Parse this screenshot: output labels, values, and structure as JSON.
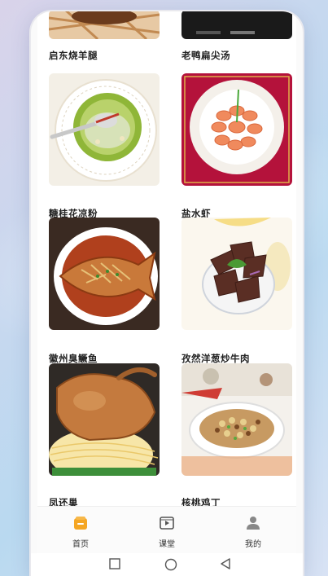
{
  "recipes": [
    {
      "name": "启东烧羊腿"
    },
    {
      "name": "老鸭扁尖汤"
    },
    {
      "name": "糖桂花凉粉"
    },
    {
      "name": "盐水虾"
    },
    {
      "name": "徽州臭鳜鱼"
    },
    {
      "name": "孜然洋葱炒牛肉"
    },
    {
      "name": "凤还巢"
    },
    {
      "name": "核桃鸡丁"
    }
  ],
  "tabs": [
    {
      "label": "首页",
      "icon": "home-icon",
      "active": true
    },
    {
      "label": "课堂",
      "icon": "video-icon",
      "active": false
    },
    {
      "label": "我的",
      "icon": "person-icon",
      "active": false
    }
  ],
  "colors": {
    "accent": "#f5a623",
    "text": "#222222"
  }
}
